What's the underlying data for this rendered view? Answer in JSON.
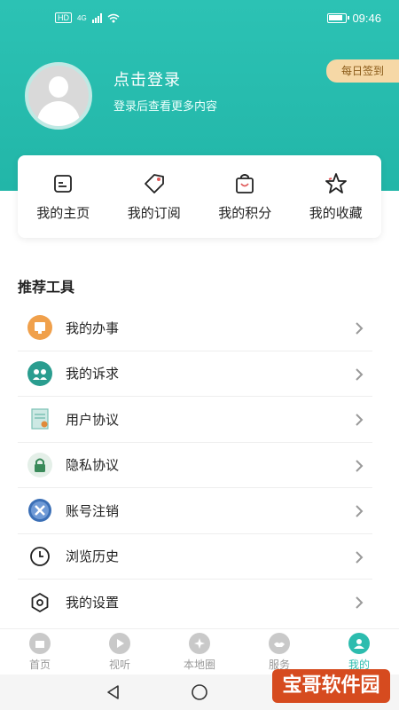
{
  "status_bar": {
    "time": "09:46",
    "network": "HD",
    "signal_label": "4G"
  },
  "profile": {
    "login_title": "点击登录",
    "login_subtitle": "登录后查看更多内容",
    "checkin_label": "每日签到"
  },
  "quick_actions": [
    {
      "label": "我的主页",
      "icon": "homepage-icon"
    },
    {
      "label": "我的订阅",
      "icon": "tag-icon"
    },
    {
      "label": "我的积分",
      "icon": "shopping-bag-icon"
    },
    {
      "label": "我的收藏",
      "icon": "star-icon"
    }
  ],
  "tools": {
    "title": "推荐工具",
    "items": [
      {
        "label": "我的办事",
        "icon": "affairs-icon",
        "color": "#f0a04b"
      },
      {
        "label": "我的诉求",
        "icon": "appeal-icon",
        "color": "#2a9d8f"
      },
      {
        "label": "用户协议",
        "icon": "agreement-icon",
        "color": "#7cc1b5"
      },
      {
        "label": "隐私协议",
        "icon": "lock-icon",
        "color": "#3a8a5a"
      },
      {
        "label": "账号注销",
        "icon": "cancel-account-icon",
        "color": "#3b6fb6"
      },
      {
        "label": "浏览历史",
        "icon": "clock-icon",
        "color": "#222222"
      },
      {
        "label": "我的设置",
        "icon": "settings-icon",
        "color": "#222222"
      }
    ]
  },
  "bottom_nav": [
    {
      "label": "首页",
      "icon": "home-icon",
      "active": false
    },
    {
      "label": "视听",
      "icon": "play-icon",
      "active": false
    },
    {
      "label": "本地圈",
      "icon": "local-icon",
      "active": false
    },
    {
      "label": "服务",
      "icon": "service-icon",
      "active": false
    },
    {
      "label": "我的",
      "icon": "profile-icon",
      "active": true
    }
  ],
  "watermark": "宝哥软件园",
  "colors": {
    "brand": "#2cbcae",
    "checkin_bg": "#f6d8a6",
    "checkin_text": "#8a5a18"
  }
}
